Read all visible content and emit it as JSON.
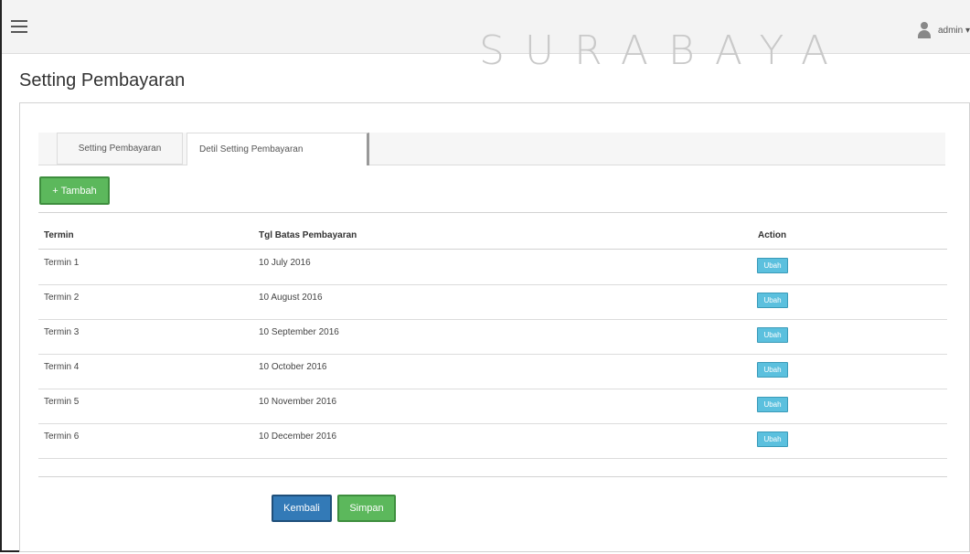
{
  "header": {
    "watermark": "SURABAYA",
    "user_label": "admin ▾"
  },
  "page": {
    "title": "Setting Pembayaran"
  },
  "tabs": [
    {
      "label": "Setting Pembayaran",
      "active": false
    },
    {
      "label": "Detil Setting Pembayaran",
      "active": true
    }
  ],
  "toolbar": {
    "add_label": "+ Tambah"
  },
  "table": {
    "columns": [
      "Termin",
      "Tgl Batas Pembayaran",
      "Action"
    ],
    "rows": [
      {
        "termin": "Termin 1",
        "tgl": "10 July 2016",
        "action": "Ubah"
      },
      {
        "termin": "Termin 2",
        "tgl": "10 August 2016",
        "action": "Ubah"
      },
      {
        "termin": "Termin 3",
        "tgl": "10 September 2016",
        "action": "Ubah"
      },
      {
        "termin": "Termin 4",
        "tgl": "10 October 2016",
        "action": "Ubah"
      },
      {
        "termin": "Termin 5",
        "tgl": "10 November 2016",
        "action": "Ubah"
      },
      {
        "termin": "Termin 6",
        "tgl": "10 December 2016",
        "action": "Ubah"
      }
    ]
  },
  "footer": {
    "back_label": "Kembali",
    "save_label": "Simpan"
  },
  "colors": {
    "success": "#5cb85c",
    "primary": "#337ab7",
    "info": "#5bc0de"
  }
}
